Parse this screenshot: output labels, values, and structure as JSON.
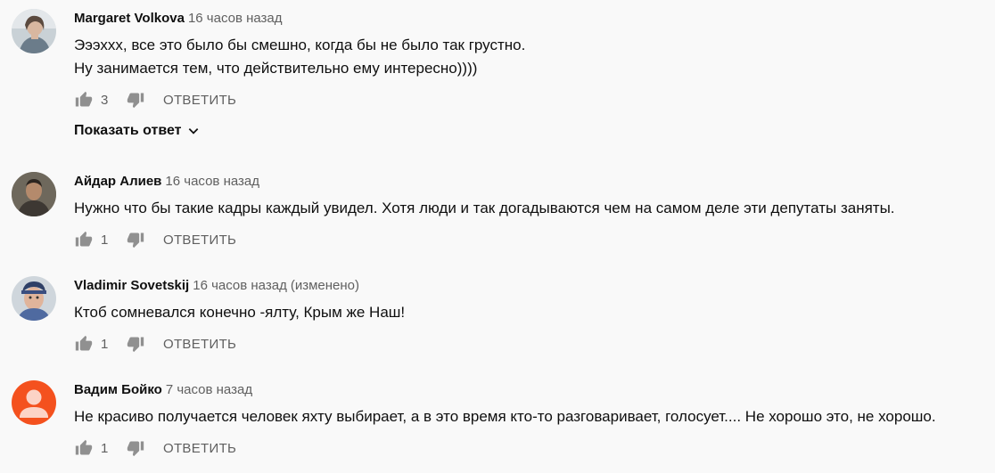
{
  "reply_label": "ОТВЕТИТЬ",
  "comments": [
    {
      "author": "Margaret Volkova",
      "time": "16 часов назад",
      "edited": "",
      "lines": [
        "Эээххх, все это было бы смешно, когда бы не было так грустно.",
        "Ну занимается тем, что действительно ему интересно))))"
      ],
      "likes": "3",
      "show_replies": "Показать ответ"
    },
    {
      "author": "Айдар Алиев",
      "time": "16 часов назад",
      "edited": "",
      "lines": [
        "Нужно что бы такие кадры каждый увидел. Хотя люди и так догадываются чем на самом деле эти депутаты заняты."
      ],
      "likes": "1"
    },
    {
      "author": "Vladimir Sovetskij",
      "time": "16 часов назад",
      "edited": "(изменено)",
      "lines": [
        "Ктоб сомневался конечно -ялту, Крым же Наш!"
      ],
      "likes": "1"
    },
    {
      "author": "Вадим Бойко",
      "time": "7 часов назад",
      "edited": "",
      "lines": [
        "Не красиво получается человек яхту выбирает, а в это время кто-то разговаривает, голосует.... Не хорошо это, не хорошо."
      ],
      "likes": "1",
      "avatar_color": "#f4511e"
    }
  ]
}
